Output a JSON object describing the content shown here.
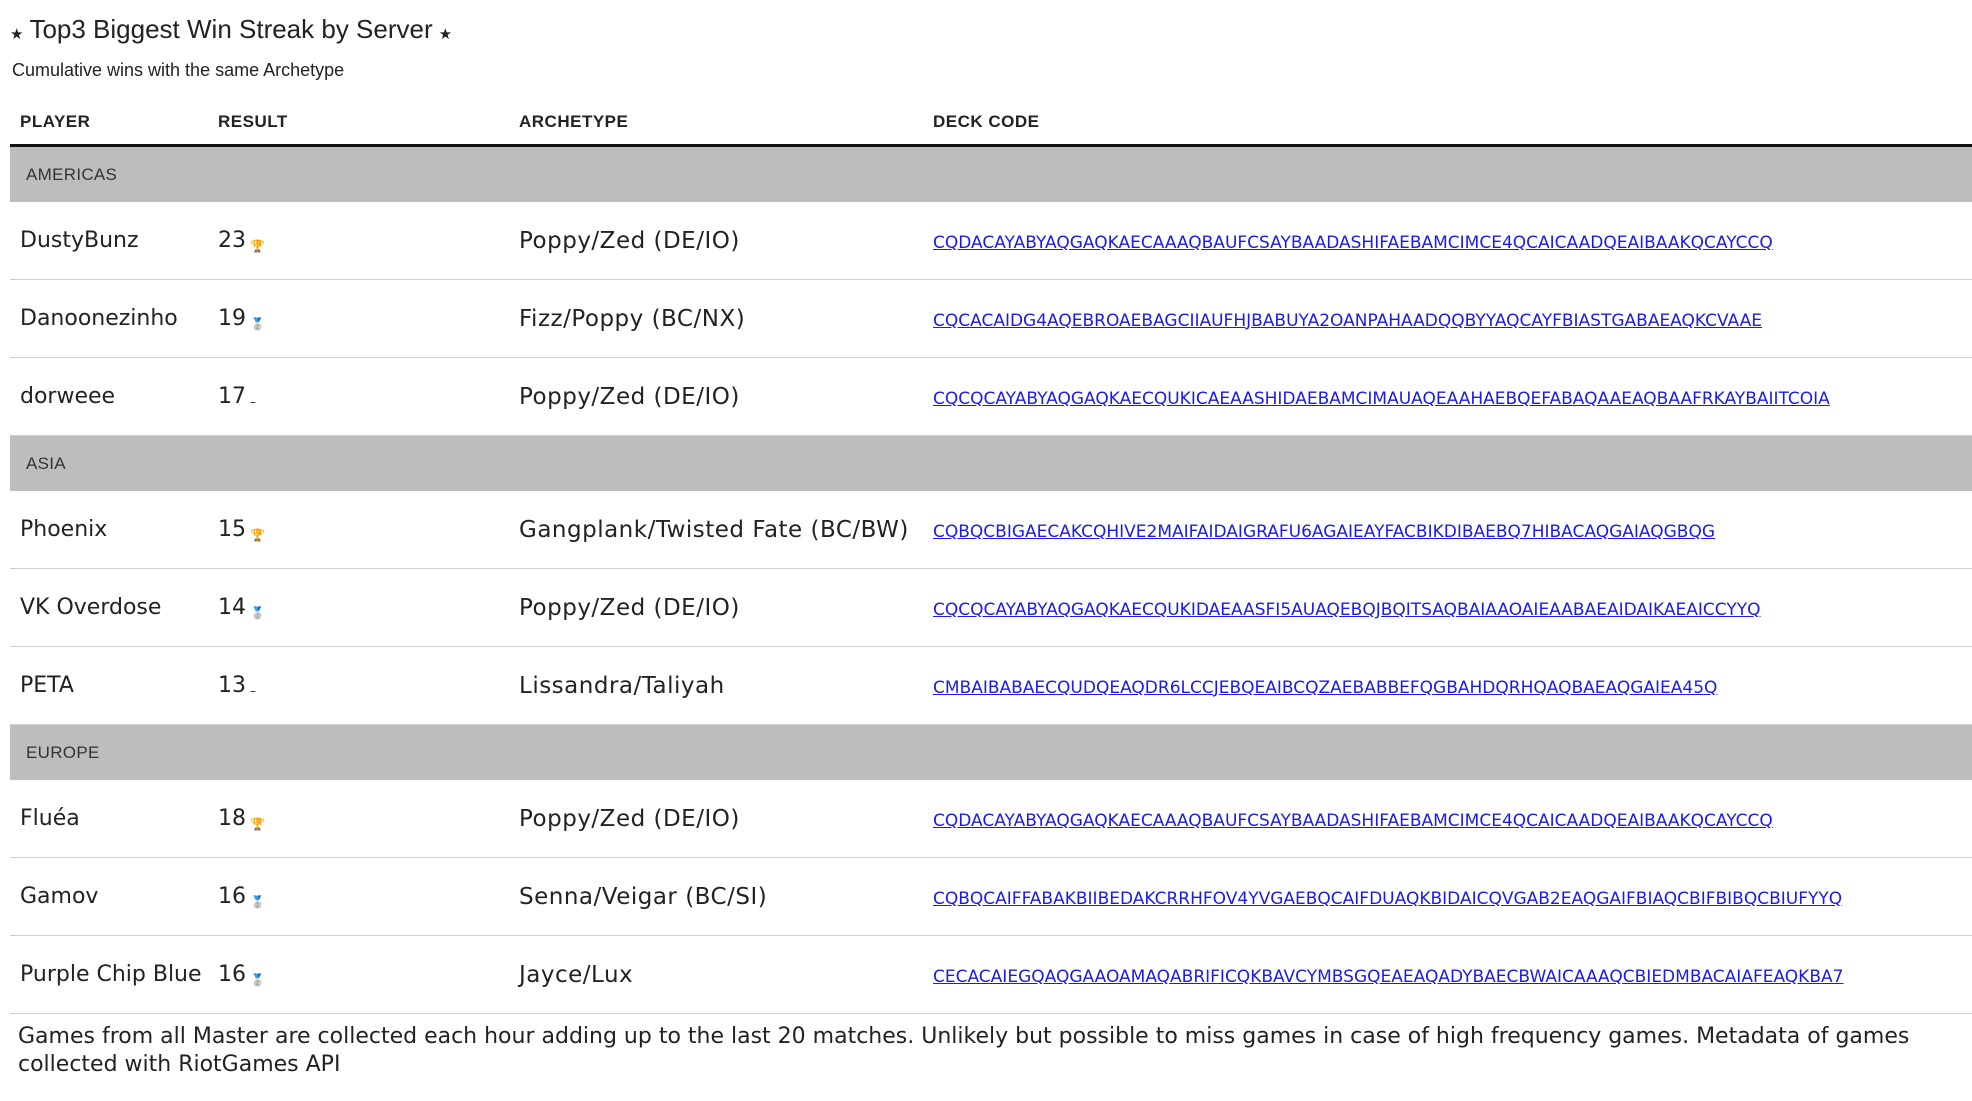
{
  "header": {
    "title": "Top3 Biggest Win Streak by Server",
    "subtitle": "Cumulative wins with the same Archetype",
    "title_icon": "star-icon"
  },
  "table": {
    "columns": [
      "PLAYER",
      "RESULT",
      "ARCHETYPE",
      "DECK CODE"
    ],
    "groups": [
      {
        "name": "AMERICAS",
        "rows": [
          {
            "player": "DustyBunz",
            "result": "23",
            "result_icon": "🏆",
            "rank_icon": "trophy-icon",
            "archetype": "Poppy/Zed (DE/IO)",
            "deck_code": "CQDACAYABYAQGAQKAECAAAQBAUFCSAYBAADASHIFAEBAMCIMCE4QCAICAADQEAIBAAKQCAYCCQ"
          },
          {
            "player": "Danoonezinho",
            "result": "19",
            "result_icon": "🥈",
            "rank_icon": "medal-icon",
            "archetype": "Fizz/Poppy (BC/NX)",
            "deck_code": "CQCACAIDG4AQEBROAEBAGCIIAUFHJBABUYA2OANPAHAADQQBYYAQCAYFBIASTGABAEAQKCVAAE"
          },
          {
            "player": "dorweee",
            "result": "17",
            "result_icon": "–",
            "rank_icon": "dash-icon",
            "archetype": "Poppy/Zed (DE/IO)",
            "deck_code": "CQCQCAYABYAQGAQKAECQUKICAEAASHIDAEBAMCIMAUAQEAAHAEBQEFABAQAAEAQBAAFRKAYBAIITCOIA"
          }
        ]
      },
      {
        "name": "ASIA",
        "rows": [
          {
            "player": "Phoenix",
            "result": "15",
            "result_icon": "🏆",
            "rank_icon": "trophy-icon",
            "archetype": "Gangplank/Twisted Fate (BC/BW)",
            "deck_code": "CQBQCBIGAECAKCQHIVE2MAIFAIDAIGRAFU6AGAIEAYFACBIKDIBAEBQ7HIBACAQGAIAQGBQG"
          },
          {
            "player": "VK Overdose",
            "result": "14",
            "result_icon": "🥈",
            "rank_icon": "medal-icon",
            "archetype": "Poppy/Zed (DE/IO)",
            "deck_code": "CQCQCAYABYAQGAQKAECQUKIDAEAASFI5AUAQEBQJBQITSAQBAIAAOAIEAABAEAIDAIKAEAICCYYQ"
          },
          {
            "player": "PETA",
            "result": "13",
            "result_icon": "–",
            "rank_icon": "dash-icon",
            "archetype": "Lissandra/Taliyah",
            "deck_code": "CMBAIBABAECQUDQEAQDR6LCCJEBQEAIBCQZAEBABBEFQGBAHDQRHQAQBAEAQGAIEA45Q"
          }
        ]
      },
      {
        "name": "EUROPE",
        "rows": [
          {
            "player": "Fluéa",
            "result": "18",
            "result_icon": "🏆",
            "rank_icon": "trophy-icon",
            "archetype": "Poppy/Zed (DE/IO)",
            "deck_code": "CQDACAYABYAQGAQKAECAAAQBAUFCSAYBAADASHIFAEBAMCIMCE4QCAICAADQEAIBAAKQCAYCCQ"
          },
          {
            "player": "Gamov",
            "result": "16",
            "result_icon": "🥈",
            "rank_icon": "medal-icon",
            "archetype": "Senna/Veigar (BC/SI)",
            "deck_code": "CQBQCAIFFABAKBIIBEDAKCRRHFOV4YVGAEBQCAIFDUAQKBIDAICQVGAB2EAQGAIFBIAQCBIFBIBQCBIUFYYQ"
          },
          {
            "player": "Purple Chip Blue",
            "result": "16",
            "result_icon": "🥈",
            "rank_icon": "medal-icon",
            "archetype": "Jayce/Lux",
            "deck_code": "CECACAIEGQAQGAAOAMAQABRIFICQKBAVCYMBSGQEAEAQADYBAECBWAICAAAQCBIEDMBACAIAFEAQKBA7"
          }
        ]
      }
    ]
  },
  "footer": {
    "note": "Games from all Master are collected each hour adding up to the last 20 matches. Unlikely but possible to miss games in case of high frequency games. Metadata of games collected with RiotGames API"
  }
}
